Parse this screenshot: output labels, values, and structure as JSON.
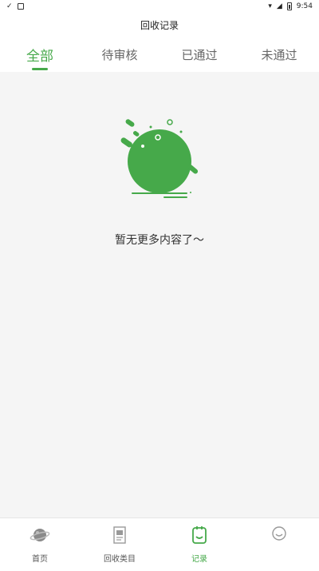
{
  "status_bar": {
    "time": "9:54"
  },
  "header": {
    "title": "回收记录"
  },
  "tabs": [
    {
      "label": "全部",
      "active": true
    },
    {
      "label": "待审核",
      "active": false
    },
    {
      "label": "已通过",
      "active": false
    },
    {
      "label": "未通过",
      "active": false
    }
  ],
  "empty_state": {
    "message": "暂无更多内容了～",
    "icon": "green-blob-illustration"
  },
  "bottom_nav": [
    {
      "label": "首页",
      "icon": "planet-icon",
      "active": false
    },
    {
      "label": "回收类目",
      "icon": "document-icon",
      "active": false
    },
    {
      "label": "记录",
      "icon": "clipboard-icon",
      "active": true
    },
    {
      "label": "",
      "icon": "smile-icon",
      "active": false
    }
  ],
  "colors": {
    "accent": "#46a94a",
    "background": "#f5f5f5"
  }
}
